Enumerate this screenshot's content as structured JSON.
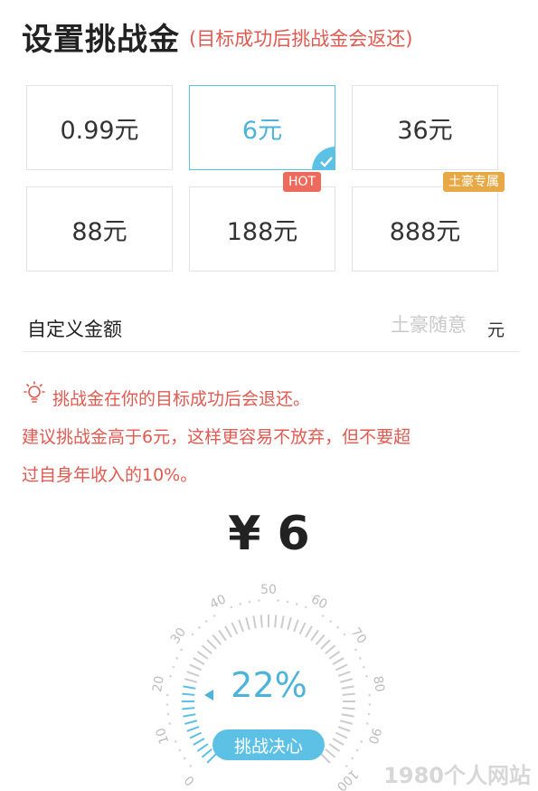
{
  "header": {
    "title": "设置挑战金",
    "subtitle": "(目标成功后挑战金会返还)"
  },
  "options": [
    {
      "label": "0.99元",
      "selected": false,
      "tag": ""
    },
    {
      "label": "6元",
      "selected": true,
      "tag": ""
    },
    {
      "label": "36元",
      "selected": false,
      "tag": ""
    },
    {
      "label": "88元",
      "selected": false,
      "tag": ""
    },
    {
      "label": "188元",
      "selected": false,
      "tag": "HOT"
    },
    {
      "label": "888元",
      "selected": false,
      "tag": "土豪专属"
    }
  ],
  "custom": {
    "label": "自定义金额",
    "placeholder": "土豪随意",
    "value": "",
    "unit": "元"
  },
  "tips": {
    "line1": "挑战金在你的目标成功后会退还。",
    "line2": "建议挑战金高于6元，这样更容易不放弃，但不要超",
    "line3": "过自身年收入的10%。"
  },
  "amount": "¥ 6",
  "gauge": {
    "percent_text": "22%",
    "value": 22,
    "ticks": [
      "0",
      "10",
      "20",
      "30",
      "40",
      "50",
      "60",
      "70",
      "80",
      "90",
      "100"
    ],
    "button_label": "挑战决心"
  },
  "watermark": "1980个人网站",
  "colors": {
    "accent": "#5cc1e4",
    "tip_red": "#e05a52",
    "hot_tag": "#ed6b5c",
    "tuhao_tag": "#e6a945"
  }
}
